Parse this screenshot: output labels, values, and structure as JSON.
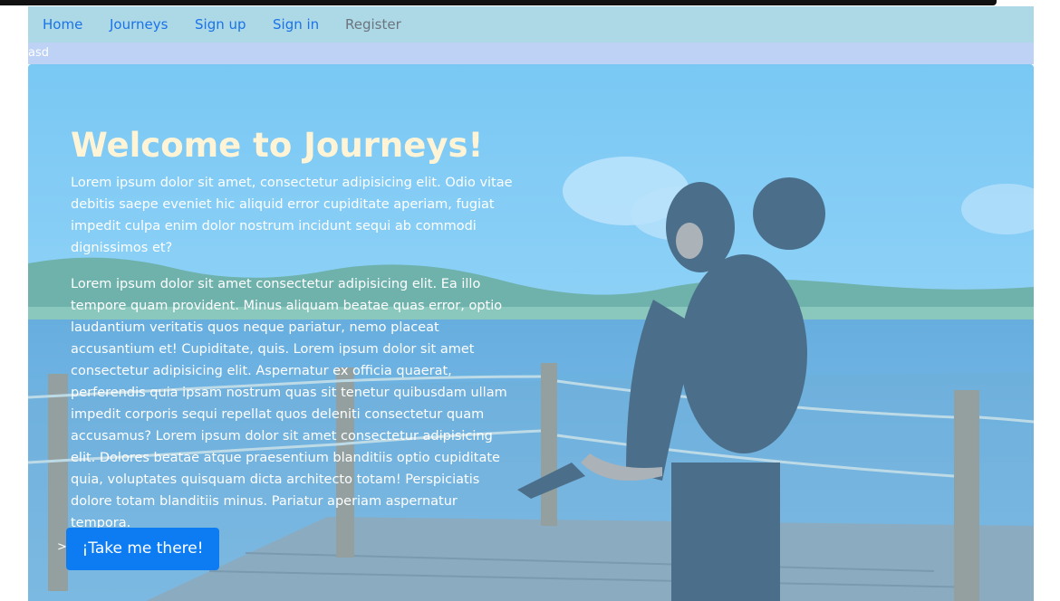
{
  "nav": {
    "items": [
      {
        "label": "Home"
      },
      {
        "label": "Journeys"
      },
      {
        "label": "Sign up"
      },
      {
        "label": "Sign in"
      },
      {
        "label": "Register"
      }
    ]
  },
  "subbar": {
    "text": "asd"
  },
  "hero": {
    "title": "Welcome to Journeys!",
    "paragraph_1": "Lorem ipsum dolor sit amet, consectetur adipisicing elit. Odio vitae debitis saepe eveniet hic aliquid error cupiditate aperiam, fugiat impedit culpa enim dolor nostrum incidunt sequi ab commodi dignissimos et?",
    "paragraph_2": "Lorem ipsum dolor sit amet consectetur adipisicing elit. Ea illo tempore quam provident. Minus aliquam beatae quas error, optio laudantium veritatis quos neque pariatur, nemo placeat accusantium et! Cupiditate, quis. Lorem ipsum dolor sit amet consectetur adipisicing elit. Aspernatur ex officia quaerat, perferendis quia ipsam nostrum quas sit tenetur quibusdam ullam impedit corporis sequi repellat quos deleniti consectetur quam accusamus? Lorem ipsum dolor sit amet consectetur adipisicing elit. Dolores beatae atque praesentium blanditiis optio cupiditate quia, voluptates quisquam dicta architecto totam! Perspiciatis dolore totam blanditiis minus. Pariatur aperiam aspernatur tempora.",
    "cta_caret": ">",
    "cta_label": "¡Take me there!"
  },
  "colors": {
    "navbar_bg": "#add8e6",
    "link": "#1a73e8",
    "link_muted": "#6c757d",
    "title": "#fff4d6",
    "cta_bg": "#0d7cf2",
    "overlay": "#87cefa"
  },
  "background_image": {
    "subject": "couple-kissing-on-lake-pier-photo"
  }
}
